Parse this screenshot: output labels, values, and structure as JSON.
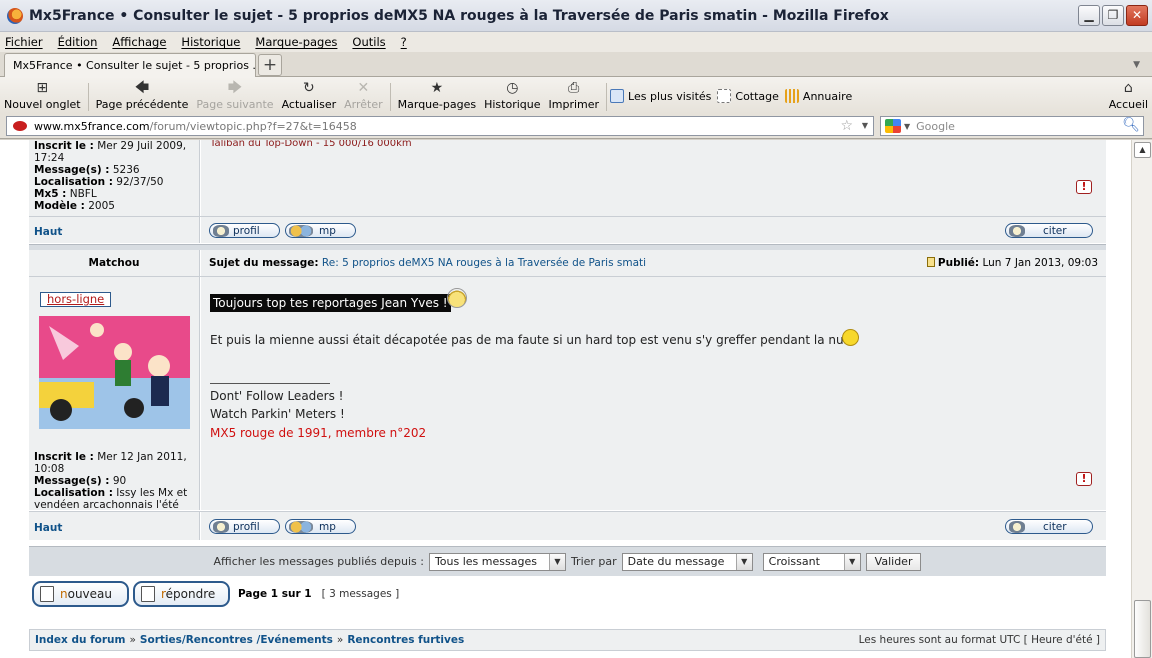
{
  "window": {
    "title": "Mx5France • Consulter le sujet - 5 proprios deMX5 NA rouges à la Traversée de Paris smatin - Mozilla Firefox"
  },
  "menu": [
    "Fichier",
    "Édition",
    "Affichage",
    "Historique",
    "Marque-pages",
    "Outils",
    "?"
  ],
  "tab": {
    "label": "Mx5France • Consulter le sujet - 5 proprios ..."
  },
  "toolbar": {
    "new_tab": "Nouvel onglet",
    "back": "Page précédente",
    "forward": "Page suivante",
    "reload": "Actualiser",
    "stop": "Arrêter",
    "bookmarks": "Marque-pages",
    "history": "Historique",
    "print": "Imprimer",
    "bm1": "Les plus visités",
    "bm2": "Cottage",
    "bm3": "Annuaire",
    "home": "Accueil"
  },
  "urlbar": {
    "host": "www.mx5france.com",
    "path": "/forum/viewtopic.php?f=27&t=16458",
    "search_placeholder": "Google"
  },
  "post1": {
    "sig": "Taliban du Top-Down - 15 000/16 000km",
    "reg_label": "Inscrit le :",
    "reg_value1": "Mer 29 Juil 2009,",
    "reg_value2": "17:24",
    "msg_label": "Message(s) :",
    "msg_value": "5236",
    "loc_label": "Localisation :",
    "loc_value": "92/37/50",
    "mx5_label": "Mx5 :",
    "mx5_value": "NBFL",
    "model_label": "Modèle :",
    "model_value": "2005"
  },
  "actions": {
    "top": "Haut",
    "profile": "profil",
    "pm": "mp",
    "quote": "citer"
  },
  "post2": {
    "author": "Matchou",
    "subject_label": "Sujet du message:",
    "subject": "Re: 5 proprios deMX5 NA rouges à la Traversée de Paris smati",
    "published_label": "Publié:",
    "published": "Lun 7 Jan 2013, 09:03",
    "status": "hors-ligne",
    "line1": "Toujours top tes reportages Jean Yves !",
    "line2": "Et puis la mienne aussi était décapotée pas de ma faute si un hard top est venu s'y greffer pendant la nuit",
    "sig1": "Dont' Follow Leaders !",
    "sig2": "Watch Parkin' Meters !",
    "sig3": "MX5 rouge de 1991, membre n°202",
    "reg_label": "Inscrit le :",
    "reg_value1": "Mer 12 Jan 2011,",
    "reg_value2": "10:08",
    "msg_label": "Message(s) :",
    "msg_value": "90",
    "loc_label": "Localisation :",
    "loc_value1": "Issy les Mx et",
    "loc_value2": "vendéen arcachonnais l'été"
  },
  "filter": {
    "show_label": "Afficher les messages publiés depuis :",
    "show_value": "Tous les messages",
    "sort_label": "Trier par",
    "sort_value": "Date du message",
    "order_value": "Croissant",
    "submit": "Valider"
  },
  "page_actions": {
    "new_prefix": "n",
    "new_rest": "ouveau",
    "reply_prefix": "r",
    "reply_rest": "épondre",
    "page_info": "Page 1 sur 1",
    "count": "[ 3 messages ]"
  },
  "breadcrumb": {
    "items": [
      "Index du forum",
      "Sorties/Rencontres /Evénements",
      "Rencontres furtives"
    ],
    "separator": "»",
    "timezone": "Les heures sont au format UTC [ Heure d'été ]"
  }
}
